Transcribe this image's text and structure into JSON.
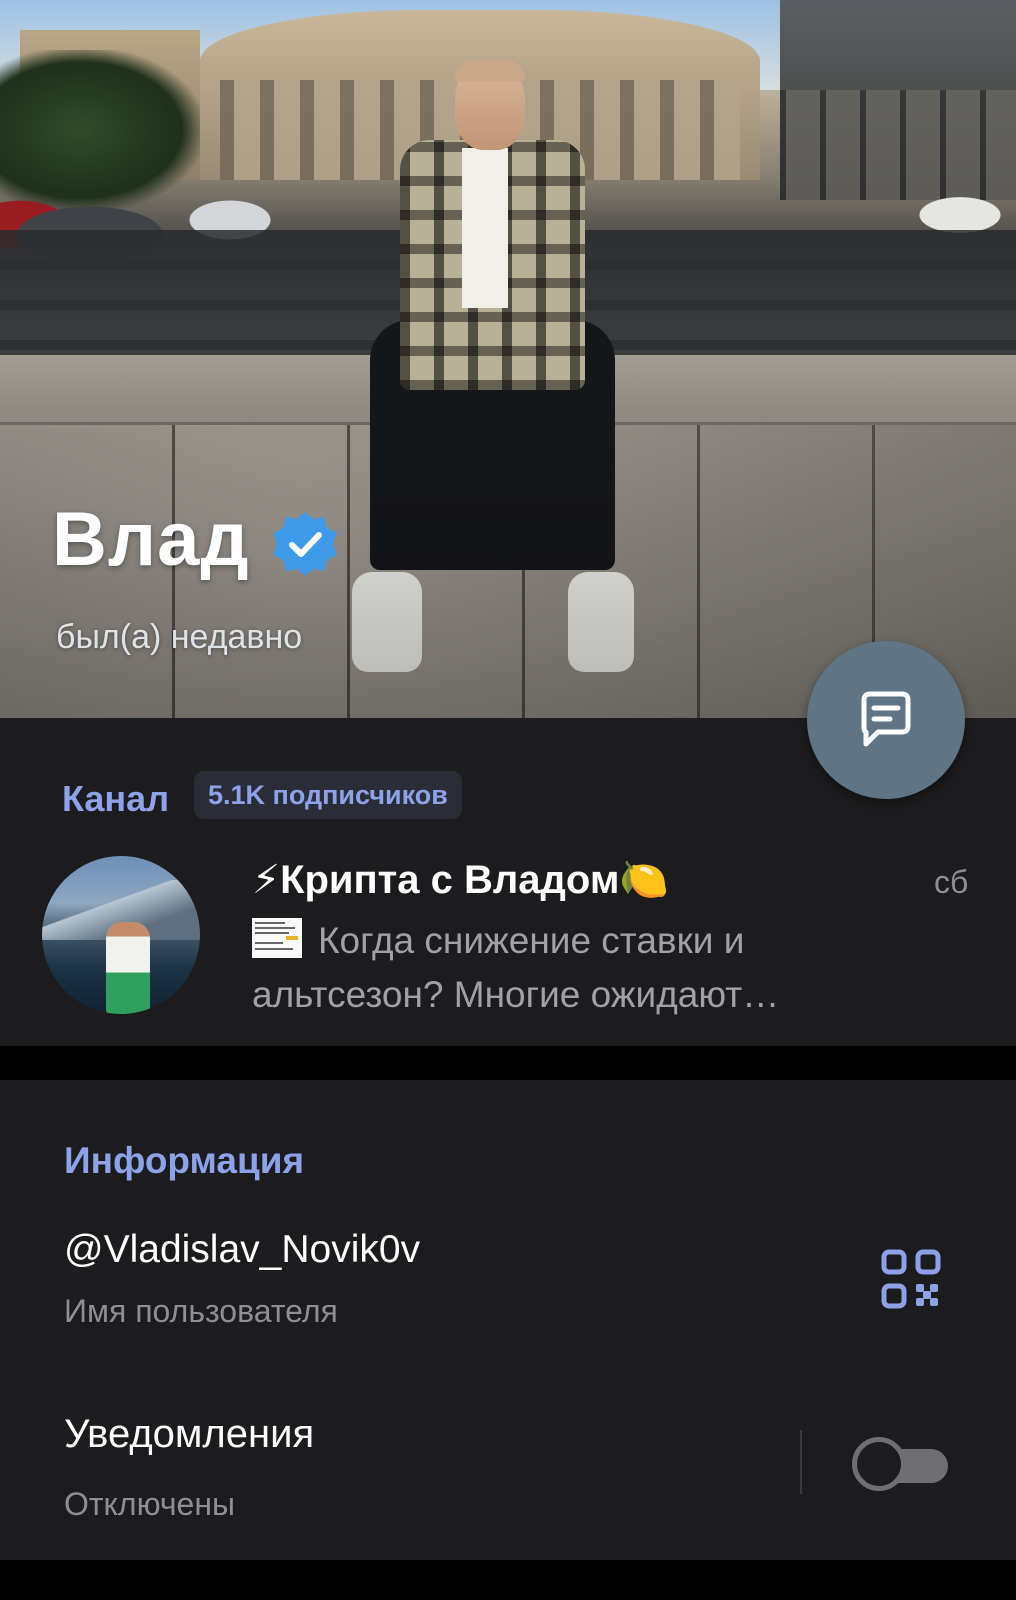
{
  "profile": {
    "name": "Влад",
    "status": "был(а) недавно"
  },
  "channel": {
    "section_label": "Канал",
    "subscribers_badge": "5.1K подписчиков",
    "title": "⚡Крипта с Владом🍋",
    "time": "сб",
    "preview": "Когда снижение ставки и альтсезон?   Многие ожидают…"
  },
  "info": {
    "section_title": "Информация",
    "username": "@Vladislav_Novik0v",
    "username_caption": "Имя пользователя",
    "notifications_label": "Уведомления",
    "notifications_caption": "Отключены",
    "notifications_enabled": false
  },
  "colors": {
    "accent": "#8da2e8",
    "fab": "#5f7586",
    "card": "#1c1c1e",
    "verified": "#3d9ae8"
  },
  "icons": {
    "verified": "verified-badge-icon",
    "fab": "message-icon",
    "qr": "qr-code-icon"
  }
}
